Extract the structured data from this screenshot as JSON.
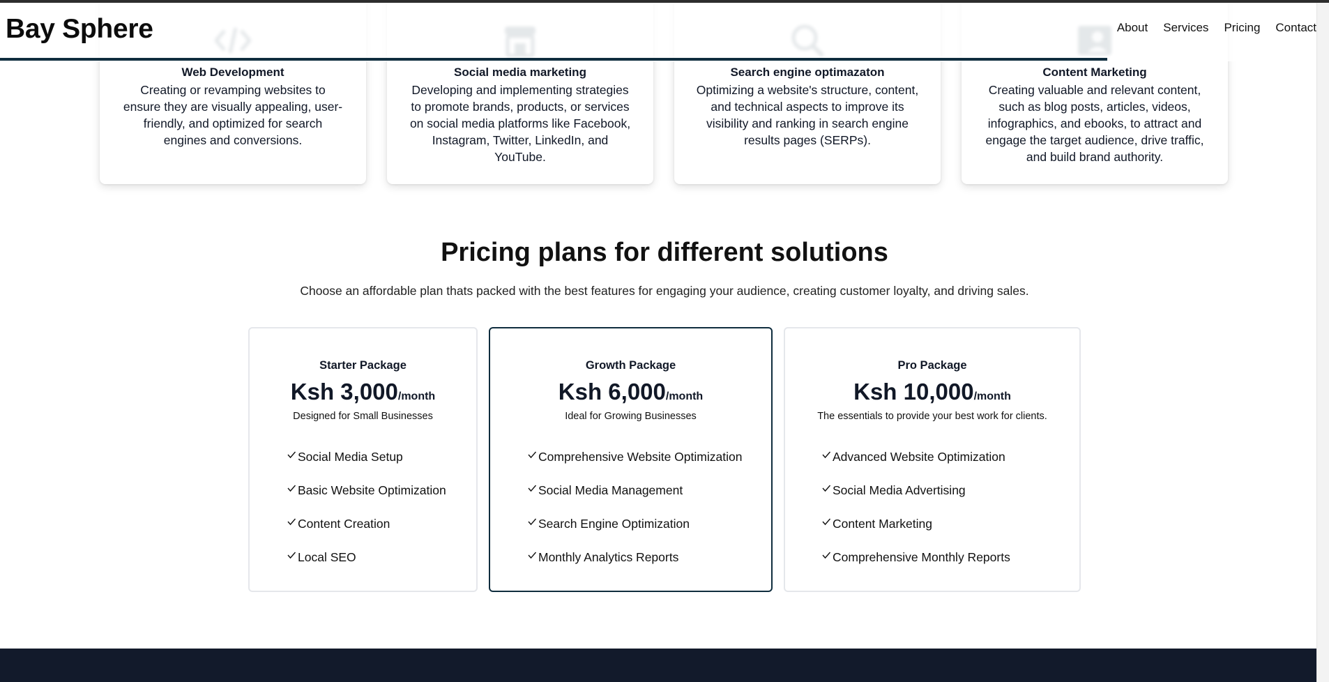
{
  "brand": "Bay Sphere",
  "nav": [
    "About",
    "Services",
    "Pricing",
    "Contact"
  ],
  "services": [
    {
      "icon": "code-icon",
      "title": "Web Development",
      "description": "Creating or revamping websites to ensure they are visually appealing, user-friendly, and optimized for search engines and conversions."
    },
    {
      "icon": "store-icon",
      "title": "Social media marketing",
      "description": "Developing and implementing strategies to promote brands, products, or services on social media platforms like Facebook, Instagram, Twitter, LinkedIn, and YouTube."
    },
    {
      "icon": "search-icon",
      "title": "Search engine optimazaton",
      "description": "Optimizing a website's structure, content, and technical aspects to improve its visibility and ranking in search engine results pages (SERPs)."
    },
    {
      "icon": "profile-icon",
      "title": "Content Marketing",
      "description": "Creating valuable and relevant content, such as blog posts, articles, videos, infographics, and ebooks, to attract and engage the target audience, drive traffic, and build brand authority."
    }
  ],
  "pricing": {
    "title": "Pricing plans for different solutions",
    "subtitle": "Choose an affordable plan thats packed with the best features for engaging your audience, creating customer loyalty, and driving sales.",
    "plans": [
      {
        "name": "Starter Package",
        "price": "Ksh 3,000",
        "period": "/month",
        "description": "Designed for Small Businesses",
        "features": [
          "Social Media Setup",
          "Basic Website Optimization",
          "Content Creation",
          "Local SEO"
        ]
      },
      {
        "name": "Growth Package",
        "price": "Ksh 6,000",
        "period": "/month",
        "description": "Ideal for Growing Businesses",
        "features": [
          "Comprehensive Website Optimization",
          "Social Media Management",
          "Search Engine Optimization",
          "Monthly Analytics Reports"
        ]
      },
      {
        "name": "Pro Package",
        "price": "Ksh 10,000",
        "period": "/month",
        "description": "The essentials to provide your best work for clients.",
        "features": [
          "Advanced Website Optimization",
          "Social Media Advertising",
          "Content Marketing",
          "Comprehensive Monthly Reports"
        ]
      }
    ]
  },
  "colors": {
    "accent": "#0f2d3e",
    "footer": "#121a2b",
    "card_border": "#e5e7eb"
  }
}
